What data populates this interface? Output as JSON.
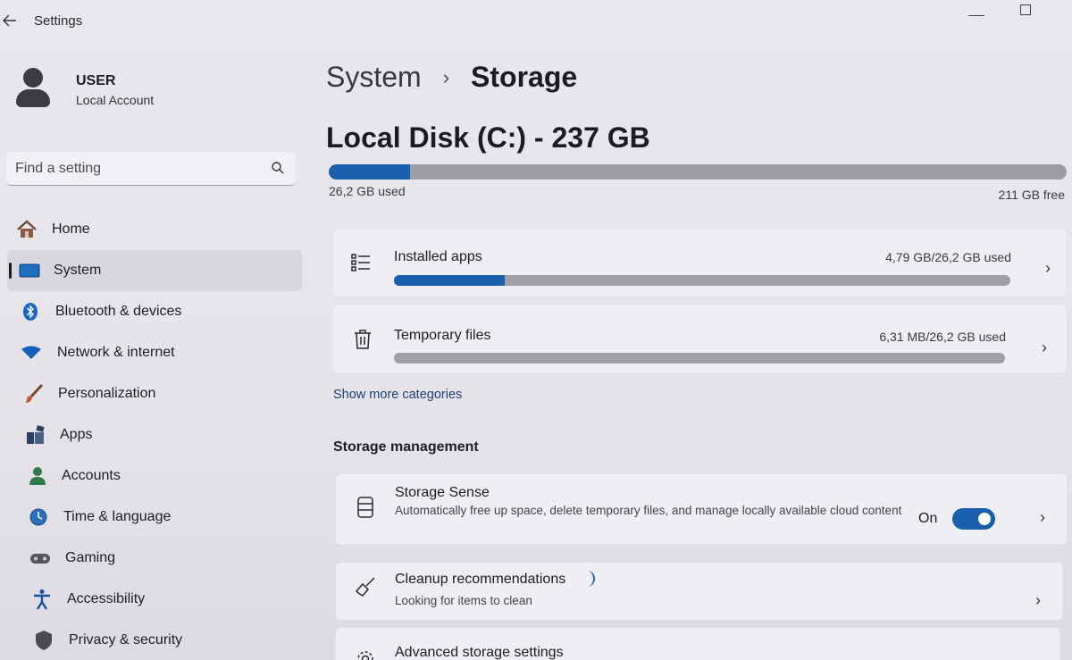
{
  "window": {
    "title": "Settings"
  },
  "profile": {
    "name": "USER",
    "account_type": "Local Account"
  },
  "search": {
    "placeholder": "Find a setting"
  },
  "nav": {
    "items": [
      {
        "label": "Home",
        "icon": "home-icon"
      },
      {
        "label": "System",
        "icon": "system-icon",
        "active": true
      },
      {
        "label": "Bluetooth & devices",
        "icon": "bluetooth-icon"
      },
      {
        "label": "Network & internet",
        "icon": "network-icon"
      },
      {
        "label": "Personalization",
        "icon": "brush-icon"
      },
      {
        "label": "Apps",
        "icon": "apps-icon"
      },
      {
        "label": "Accounts",
        "icon": "accounts-icon"
      },
      {
        "label": "Time & language",
        "icon": "globe-clock-icon"
      },
      {
        "label": "Gaming",
        "icon": "gamepad-icon"
      },
      {
        "label": "Accessibility",
        "icon": "accessibility-icon"
      },
      {
        "label": "Privacy & security",
        "icon": "shield-icon"
      }
    ]
  },
  "breadcrumb": {
    "parent": "System",
    "separator": "›",
    "current": "Storage"
  },
  "disk": {
    "title": "Local Disk (C:) - 237 GB",
    "used_label": "26,2 GB used",
    "free_label": "211 GB free",
    "used_fraction": 0.11
  },
  "categories": [
    {
      "title": "Installed apps",
      "usage": "4,79 GB/26,2 GB used",
      "fraction": 0.18,
      "icon": "list-icon"
    },
    {
      "title": "Temporary files",
      "usage": "6,31 MB/26,2 GB used",
      "fraction": 0.0,
      "icon": "trash-icon"
    }
  ],
  "show_more": "Show more categories",
  "storage_management": {
    "heading": "Storage management",
    "storage_sense": {
      "title": "Storage Sense",
      "description": "Automatically free up space, delete temporary files, and manage locally available cloud content",
      "state": "On"
    },
    "cleanup": {
      "title": "Cleanup recommendations",
      "description": "Looking for items to clean"
    },
    "advanced": {
      "title": "Advanced storage settings"
    }
  },
  "colors": {
    "accent": "#1a5fad",
    "bar_track": "#9e9ca2"
  }
}
